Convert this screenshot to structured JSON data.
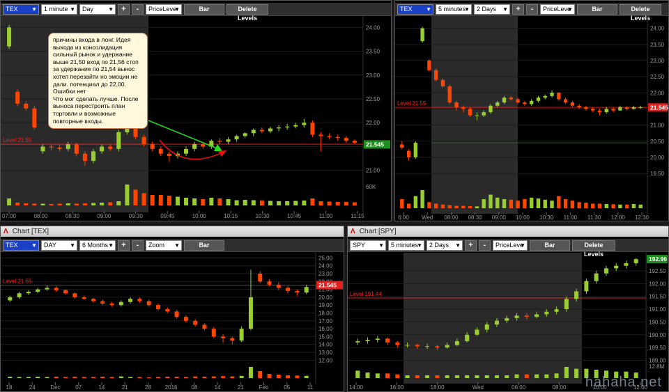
{
  "panels": [
    {
      "symbol": "TEX",
      "interval": "1 minute",
      "range": "Day",
      "study": "PriceLeve",
      "chart_style": "Bar",
      "delete_label": "Delete Levels",
      "level_label": "Level 21.55",
      "last_price": "21.545",
      "annotation": "причины входа в лонг. Идея выхода из консолидация сильный рынок и удержание выше 21,50 вход по 21,56 стоп за удержание по 21,54 вынос хотел перезайти но эмоции не дали. потенциал до 22,00.\nОшибки нет\nЧто мог сделать лучше. После выноса перестроить план торговли и возможные повторные входы."
    },
    {
      "symbol": "TEX",
      "interval": "5 minutes",
      "range": "2 Days",
      "study": "PriceLeve",
      "chart_style": "Bar",
      "delete_label": "Delete Levels",
      "level_label": "Level 21.55",
      "last_price": "21.545"
    },
    {
      "window_title": "Chart [TEX]",
      "symbol": "TEX",
      "interval": "DAY",
      "range": "6 Months",
      "study": "Zoom",
      "chart_style": "Bar",
      "level_label": "Level 21.55",
      "last_price": "21.545"
    },
    {
      "window_title": "Chart [SPY]",
      "symbol": "SPY",
      "interval": "5 minutes",
      "range": "2 Days",
      "study": "PriceLeve",
      "chart_style": "Bar",
      "delete_label": "Delete Levels",
      "level_label": "Level 191.44",
      "last_price": "192.96"
    }
  ],
  "icons": {
    "plus": "plus-icon",
    "minus": "minus-icon",
    "dropdown": "chevron-down-icon",
    "app": "chart-app-icon"
  },
  "colors": {
    "up": "#9acd32",
    "down": "#ff4500",
    "level": "#ff2020",
    "session_bg": "#2a2a2a",
    "price_tag_up": "#1e8f1e",
    "price_tag_down": "#e02020",
    "annotation_border": "#d08050",
    "arrow_green": "#22dd22",
    "arrow_red": "#ee1111"
  },
  "watermark": "hahaha.net",
  "chart_data": [
    {
      "type": "candlestick",
      "series_name": "TEX 1 minute",
      "x_ticks": [
        "07:00",
        "08:00",
        "08:30",
        "09:00",
        "09:30",
        "09:45",
        "10:00",
        "10:15",
        "10:30",
        "10:45",
        "11:00",
        "11:15"
      ],
      "y_ticks": [
        24.0,
        23.5,
        23.0,
        22.5,
        22.0,
        21.5,
        21.0
      ],
      "ylim": [
        20.85,
        24.15
      ],
      "volume_label": "60K",
      "level": 21.55,
      "last": 21.545,
      "x": [
        "07:00",
        "07:10",
        "07:20",
        "07:30",
        "07:40",
        "08:00",
        "08:10",
        "08:20",
        "08:30",
        "08:40",
        "08:50",
        "09:00",
        "09:10",
        "09:20",
        "09:30",
        "09:33",
        "09:36",
        "09:39",
        "09:42",
        "09:45",
        "09:48",
        "09:51",
        "09:54",
        "09:57",
        "10:00",
        "10:03",
        "10:06",
        "10:09",
        "10:12",
        "10:15",
        "10:20",
        "10:25",
        "10:30",
        "10:35",
        "10:40",
        "10:45",
        "10:50",
        "10:55",
        "11:00",
        "11:05",
        "11:10",
        "11:15"
      ],
      "open": [
        23.6,
        22.65,
        22.4,
        22.3,
        21.4,
        21.5,
        21.48,
        21.45,
        21.55,
        21.35,
        21.2,
        21.4,
        21.5,
        21.45,
        21.8,
        21.9,
        21.7,
        21.55,
        21.45,
        21.35,
        21.3,
        21.35,
        21.45,
        21.55,
        21.5,
        21.62,
        21.6,
        21.65,
        21.72,
        21.78,
        21.85,
        21.82,
        21.88,
        21.9,
        21.92,
        21.95,
        22.0,
        21.75,
        21.72,
        21.7,
        21.68,
        21.62
      ],
      "close": [
        24.0,
        22.4,
        22.3,
        21.9,
        21.5,
        21.48,
        21.45,
        21.55,
        21.35,
        21.2,
        21.4,
        21.5,
        21.45,
        21.8,
        21.9,
        21.7,
        21.55,
        21.45,
        21.35,
        21.3,
        21.35,
        21.45,
        21.55,
        21.5,
        21.62,
        21.6,
        21.65,
        21.72,
        21.78,
        21.85,
        21.82,
        21.88,
        21.9,
        21.92,
        21.95,
        22.0,
        21.75,
        21.72,
        21.7,
        21.68,
        21.62,
        21.58
      ],
      "high": [
        24.05,
        22.7,
        22.45,
        22.35,
        21.55,
        21.55,
        21.55,
        21.6,
        21.58,
        21.4,
        21.45,
        21.55,
        21.55,
        21.85,
        21.95,
        21.95,
        21.75,
        21.6,
        21.5,
        21.4,
        21.4,
        21.5,
        21.6,
        21.6,
        21.65,
        21.68,
        21.7,
        21.75,
        21.8,
        21.88,
        21.9,
        21.92,
        21.95,
        21.98,
        22.0,
        22.08,
        22.05,
        21.8,
        21.78,
        21.75,
        21.72,
        21.65
      ],
      "low": [
        23.55,
        22.35,
        22.25,
        21.85,
        21.35,
        21.42,
        21.4,
        21.4,
        21.3,
        21.1,
        21.15,
        21.35,
        21.4,
        21.4,
        21.75,
        21.65,
        21.5,
        21.4,
        21.3,
        21.18,
        21.25,
        21.3,
        21.4,
        21.45,
        21.45,
        21.55,
        21.55,
        21.6,
        21.68,
        21.72,
        21.78,
        21.78,
        21.82,
        21.85,
        21.88,
        21.9,
        21.7,
        21.4,
        21.65,
        21.62,
        21.58,
        21.55
      ],
      "volume": [
        20,
        8,
        6,
        5,
        5,
        4,
        5,
        6,
        5,
        6,
        7,
        8,
        9,
        12,
        60,
        45,
        35,
        30,
        30,
        28,
        25,
        22,
        20,
        18,
        22,
        20,
        18,
        15,
        16,
        15,
        14,
        13,
        12,
        12,
        13,
        14,
        20,
        12,
        11,
        10,
        10,
        9
      ]
    },
    {
      "type": "candlestick",
      "series_name": "TEX 5 minutes",
      "x_ticks": [
        "6:00",
        "Wed",
        "08:00",
        "08:30",
        "09:00",
        "10:00",
        "10:30",
        "11:00",
        "11:30",
        "12:00",
        "12:30"
      ],
      "y_ticks": [
        24.0,
        23.5,
        23.0,
        22.5,
        22.0,
        21.5,
        21.0,
        20.5,
        20.0,
        19.5
      ],
      "ylim": [
        19.2,
        24.25
      ],
      "level": 21.55,
      "last": 21.545,
      "secondary_line": 20.45,
      "x": [
        "06:00",
        "06:30",
        "07:00",
        "07:30",
        "07:40",
        "07:50",
        "08:00",
        "08:10",
        "08:20",
        "08:30",
        "08:40",
        "08:50",
        "09:00",
        "09:10",
        "09:20",
        "09:30",
        "09:40",
        "09:50",
        "10:00",
        "10:10",
        "10:20",
        "10:30",
        "10:40",
        "10:50",
        "11:00",
        "11:10",
        "11:20",
        "11:30",
        "11:40",
        "11:50",
        "12:00",
        "12:10",
        "12:20",
        "12:30",
        "12:40",
        "12:50"
      ],
      "open": [
        20.4,
        20.2,
        20.0,
        23.6,
        23.0,
        22.7,
        22.4,
        22.2,
        21.7,
        21.55,
        21.5,
        21.3,
        21.3,
        21.4,
        21.6,
        21.7,
        21.85,
        21.8,
        21.7,
        21.65,
        21.75,
        21.85,
        21.9,
        22.0,
        21.8,
        21.7,
        21.6,
        21.55,
        21.5,
        21.45,
        21.4,
        21.5,
        21.45,
        21.55,
        21.5,
        21.55
      ],
      "close": [
        20.3,
        20.0,
        20.45,
        24.0,
        22.7,
        22.4,
        22.2,
        21.7,
        21.55,
        21.5,
        21.3,
        21.3,
        21.4,
        21.6,
        21.7,
        21.85,
        21.8,
        21.7,
        21.65,
        21.75,
        21.85,
        21.9,
        22.0,
        21.8,
        21.7,
        21.6,
        21.55,
        21.5,
        21.45,
        21.4,
        21.5,
        21.45,
        21.55,
        21.5,
        21.55,
        21.55
      ],
      "high": [
        20.5,
        20.25,
        20.5,
        24.05,
        23.05,
        22.75,
        22.45,
        22.25,
        21.75,
        21.6,
        21.55,
        21.4,
        21.45,
        21.65,
        21.75,
        21.9,
        21.9,
        21.85,
        21.75,
        21.8,
        21.9,
        21.95,
        22.08,
        22.02,
        21.85,
        21.75,
        21.65,
        21.6,
        21.55,
        21.5,
        21.55,
        21.55,
        21.6,
        21.58,
        21.6,
        21.6
      ],
      "low": [
        20.25,
        19.9,
        19.95,
        23.55,
        22.65,
        22.35,
        22.15,
        21.65,
        21.45,
        21.4,
        21.25,
        21.15,
        21.25,
        21.35,
        21.55,
        21.65,
        21.75,
        21.65,
        21.6,
        21.6,
        21.7,
        21.8,
        21.85,
        21.75,
        21.65,
        21.55,
        21.5,
        21.45,
        21.4,
        21.3,
        21.35,
        21.4,
        21.45,
        21.45,
        21.48,
        21.5
      ],
      "volume": [
        30,
        15,
        40,
        60,
        20,
        15,
        12,
        10,
        8,
        8,
        7,
        6,
        30,
        45,
        35,
        30,
        28,
        25,
        30,
        35,
        32,
        28,
        25,
        40,
        30,
        25,
        20,
        18,
        15,
        15,
        14,
        13,
        12,
        12,
        14,
        12
      ]
    },
    {
      "type": "candlestick",
      "series_name": "TEX DAY",
      "x_ticks": [
        "18",
        "24",
        "Dec",
        "07",
        "14",
        "21",
        "28",
        "2016",
        "08",
        "14",
        "21",
        "Feb",
        "05",
        "11"
      ],
      "y_ticks": [
        25.0,
        24.0,
        23.0,
        22.0,
        21.0,
        20.0,
        19.0,
        18.0,
        17.0,
        16.0,
        15.0,
        14.0,
        13.0,
        12.0
      ],
      "ylim": [
        11.5,
        25.3
      ],
      "level": 21.55,
      "last": 21.545,
      "x": [
        "Nov 16",
        "Nov 18",
        "Nov 20",
        "Nov 24",
        "Nov 27",
        "Dec 01",
        "Dec 03",
        "Dec 07",
        "Dec 09",
        "Dec 11",
        "Dec 14",
        "Dec 16",
        "Dec 18",
        "Dec 21",
        "Dec 23",
        "Dec 28",
        "Dec 30",
        "Jan 04",
        "Jan 06",
        "Jan 08",
        "Jan 12",
        "Jan 14",
        "Jan 19",
        "Jan 21",
        "Jan 25",
        "Jan 27",
        "Jan 29",
        "Feb 01",
        "Feb 03",
        "Feb 05",
        "Feb 09",
        "Feb 11",
        "Feb 12"
      ],
      "open": [
        19.6,
        20.0,
        20.5,
        20.7,
        21.0,
        21.2,
        20.9,
        20.5,
        20.0,
        19.8,
        19.5,
        19.2,
        19.0,
        19.4,
        19.8,
        19.5,
        19.0,
        18.5,
        18.2,
        17.5,
        17.0,
        16.5,
        16.0,
        15.0,
        14.8,
        14.5,
        16.0,
        23.0,
        22.0,
        21.6,
        21.2,
        20.8,
        20.6
      ],
      "close": [
        20.0,
        20.5,
        20.7,
        21.0,
        21.2,
        20.9,
        20.5,
        20.0,
        19.8,
        19.5,
        19.2,
        19.0,
        19.4,
        19.8,
        19.5,
        19.0,
        18.5,
        18.2,
        17.5,
        17.0,
        16.5,
        16.0,
        15.0,
        14.8,
        14.5,
        16.0,
        20.0,
        22.0,
        21.6,
        21.2,
        20.8,
        20.6,
        21.3
      ],
      "high": [
        20.2,
        20.7,
        20.9,
        21.2,
        21.5,
        21.4,
        21.0,
        20.6,
        20.2,
        19.9,
        19.7,
        19.4,
        19.6,
        20.0,
        20.0,
        19.7,
        19.2,
        18.7,
        18.4,
        17.7,
        17.2,
        16.7,
        16.2,
        15.3,
        15.0,
        16.3,
        23.5,
        23.3,
        22.3,
        21.9,
        21.4,
        21.0,
        21.6
      ],
      "low": [
        19.4,
        19.8,
        20.3,
        20.5,
        20.8,
        20.7,
        20.3,
        19.8,
        19.7,
        19.3,
        19.0,
        18.8,
        18.8,
        19.2,
        19.3,
        18.8,
        18.3,
        18.0,
        17.3,
        16.8,
        16.3,
        15.8,
        14.8,
        14.2,
        14.0,
        14.3,
        15.8,
        21.8,
        21.4,
        20.9,
        20.5,
        20.2,
        20.4
      ],
      "volume": [
        5,
        4,
        4,
        5,
        4,
        5,
        4,
        5,
        4,
        4,
        5,
        4,
        6,
        4,
        4,
        3,
        4,
        5,
        5,
        4,
        6,
        5,
        6,
        7,
        6,
        8,
        40,
        25,
        15,
        12,
        10,
        9,
        8
      ]
    },
    {
      "type": "candlestick",
      "series_name": "SPY 5 minutes",
      "x_ticks": [
        "14:00",
        "16:00",
        "18:00",
        "Wed",
        "06:00",
        "08:00",
        "10:00",
        "12:00"
      ],
      "y_ticks": [
        192.5,
        192.0,
        191.5,
        191.0,
        190.5,
        190.0,
        189.5,
        189.0
      ],
      "ylim": [
        188.85,
        193.1
      ],
      "volume_label": "12.8M",
      "level": 191.44,
      "last": 192.96,
      "x": [
        "14:00",
        "14:30",
        "15:00",
        "15:30",
        "16:00",
        "16:30",
        "17:00",
        "17:30",
        "18:00",
        "18:30",
        "19:00",
        "19:30",
        "Wed",
        "02:00",
        "03:00",
        "04:00",
        "05:00",
        "06:00",
        "07:00",
        "08:00",
        "09:00",
        "09:30",
        "10:00",
        "10:30",
        "11:00",
        "11:30",
        "12:00",
        "12:30",
        "13:00"
      ],
      "open": [
        189.7,
        189.75,
        189.8,
        189.85,
        189.7,
        189.6,
        189.6,
        189.55,
        189.55,
        189.5,
        189.6,
        189.75,
        190.0,
        190.2,
        190.4,
        190.55,
        190.65,
        190.75,
        190.7,
        190.8,
        190.9,
        191.0,
        191.4,
        191.7,
        192.1,
        192.4,
        192.6,
        192.7,
        192.8
      ],
      "close": [
        189.75,
        189.8,
        189.85,
        189.7,
        189.6,
        189.6,
        189.55,
        189.55,
        189.5,
        189.6,
        189.75,
        190.0,
        190.2,
        190.4,
        190.55,
        190.65,
        190.75,
        190.7,
        190.8,
        190.9,
        191.0,
        191.4,
        191.7,
        192.1,
        192.4,
        192.6,
        192.7,
        192.8,
        192.96
      ],
      "high": [
        189.85,
        189.9,
        189.95,
        189.9,
        189.75,
        189.7,
        189.65,
        189.65,
        189.6,
        189.7,
        189.85,
        190.1,
        190.3,
        190.5,
        190.65,
        190.75,
        190.85,
        190.85,
        190.9,
        191.0,
        191.1,
        191.5,
        191.8,
        192.2,
        192.5,
        192.7,
        192.8,
        192.9,
        193.0
      ],
      "low": [
        189.6,
        189.65,
        189.7,
        189.6,
        189.5,
        189.5,
        189.45,
        189.45,
        189.4,
        189.45,
        189.55,
        189.7,
        189.95,
        190.1,
        190.3,
        190.45,
        190.55,
        190.6,
        190.65,
        190.7,
        190.8,
        190.9,
        191.3,
        191.6,
        192.0,
        192.3,
        192.5,
        192.6,
        192.7
      ],
      "volume": [
        8,
        6,
        5,
        5,
        4,
        3,
        3,
        3,
        3,
        3,
        3,
        3,
        3,
        3,
        3,
        3,
        4,
        4,
        4,
        4,
        5,
        12,
        10,
        10,
        9,
        8,
        7,
        7,
        6
      ]
    }
  ]
}
